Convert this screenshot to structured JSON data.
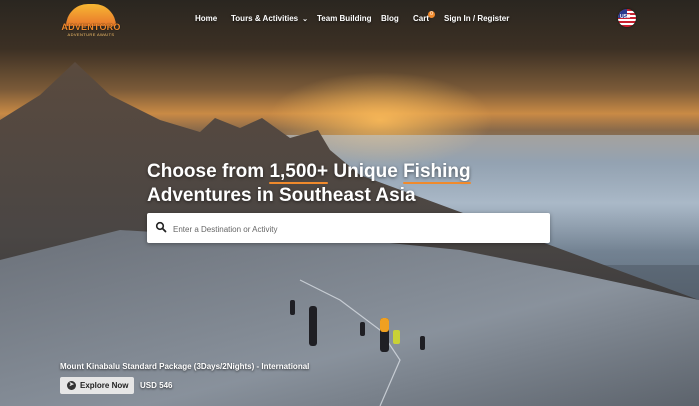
{
  "header": {
    "logo": {
      "word": "ADVENTORO",
      "tagline": "ADVENTURE AWAITS"
    },
    "nav": [
      {
        "label": "Home"
      },
      {
        "label": "Tours & Activities"
      },
      {
        "label": "Team Building"
      },
      {
        "label": "Blog"
      },
      {
        "label": "Cart"
      },
      {
        "label": "Sign In / Register"
      }
    ],
    "cart_count": "0",
    "flag_label": "USD"
  },
  "hero": {
    "headline_prefix": "Choose from ",
    "headline_count": "1,500+",
    "headline_mid": " Unique ",
    "headline_activity": "Fishing",
    "headline_line2": "Adventures in Southeast Asia"
  },
  "search": {
    "placeholder": "Enter a Destination or Activity"
  },
  "feature": {
    "title": "Mount Kinabalu Standard Package (3Days/2Nights) - International",
    "button": "Explore Now",
    "price": "USD 546"
  },
  "colors": {
    "accent": "#f08a2c"
  }
}
